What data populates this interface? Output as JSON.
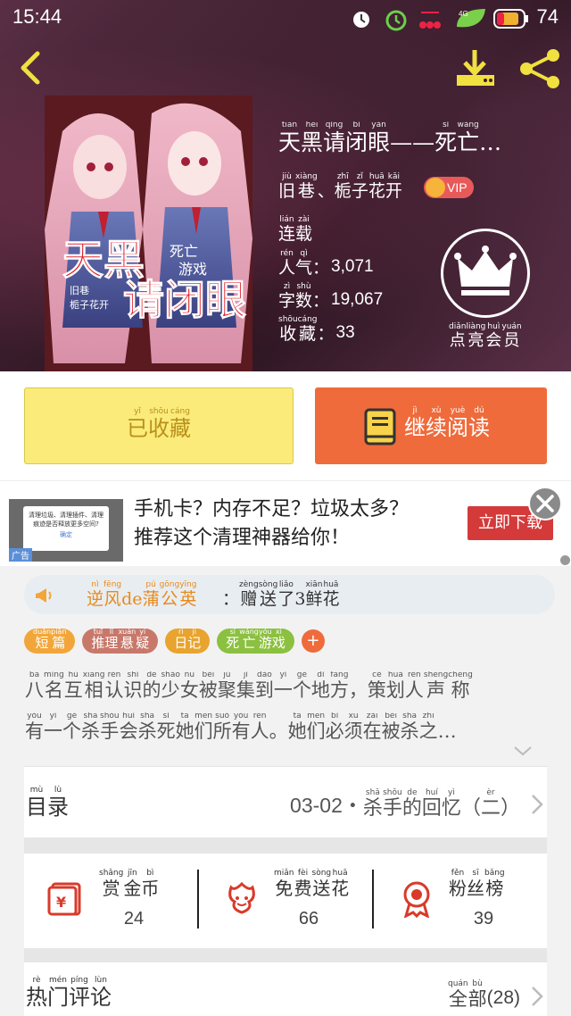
{
  "status_bar": {
    "time": "15:44",
    "battery": "74",
    "network": "4G"
  },
  "colors": {
    "accent_orange": "#ef6b3b",
    "collect_yellow": "#fbeb7a",
    "vip_red": "#e85a5a",
    "gift_user_orange": "#e88a1a"
  },
  "book": {
    "title": [
      {
        "c": "天",
        "p": "tiān"
      },
      {
        "c": "黑",
        "p": "hēi"
      },
      {
        "c": "请",
        "p": "qǐng"
      },
      {
        "c": "闭",
        "p": "bì"
      },
      {
        "c": "眼",
        "p": "yǎn"
      },
      {
        "c": "——",
        "p": ""
      },
      {
        "c": "死",
        "p": "sǐ"
      },
      {
        "c": "亡",
        "p": "wáng"
      },
      {
        "c": "…",
        "p": ""
      }
    ],
    "author": [
      {
        "c": "旧",
        "p": "jiù"
      },
      {
        "c": "巷",
        "p": "xiàng"
      },
      {
        "c": "、",
        "p": ""
      },
      {
        "c": "栀",
        "p": "zhī"
      },
      {
        "c": "子",
        "p": "zǐ"
      },
      {
        "c": "花",
        "p": "huā"
      },
      {
        "c": "开",
        "p": "kāi"
      }
    ],
    "vip_label": "VIP",
    "status": [
      {
        "c": "连",
        "p": "lián"
      },
      {
        "c": "载",
        "p": "zài"
      }
    ],
    "popularity_label": [
      {
        "c": "人",
        "p": "rén"
      },
      {
        "c": "气",
        "p": "qì"
      },
      {
        "c": "：",
        "p": ""
      }
    ],
    "popularity": "3,071",
    "word_count_label": [
      {
        "c": "字",
        "p": "zì"
      },
      {
        "c": "数",
        "p": "shù"
      },
      {
        "c": "：",
        "p": ""
      }
    ],
    "word_count": "19,067",
    "favorites_label": [
      {
        "c": "收",
        "p": "shōu"
      },
      {
        "c": "藏",
        "p": "cáng"
      },
      {
        "c": "：",
        "p": ""
      }
    ],
    "favorites": "33",
    "member_label": [
      {
        "c": "点",
        "p": "diǎn"
      },
      {
        "c": "亮",
        "p": "liàng"
      },
      {
        "c": "会",
        "p": "huì"
      },
      {
        "c": "员",
        "p": "yuán"
      }
    ]
  },
  "actions": {
    "collect": [
      {
        "c": "已",
        "p": "yǐ"
      },
      {
        "c": "收",
        "p": "shōu"
      },
      {
        "c": "藏",
        "p": "cáng"
      }
    ],
    "read": [
      {
        "c": "继",
        "p": "jì"
      },
      {
        "c": "续",
        "p": "xù"
      },
      {
        "c": "阅",
        "p": "yuè"
      },
      {
        "c": "读",
        "p": "dú"
      }
    ]
  },
  "ad": {
    "line1": "手机卡？内存不足？垃圾太多？",
    "line2": "推荐这个清理神器给你！",
    "cta": "立即下载",
    "tag": "广告",
    "thumb_text": "清理垃圾、清理插件、清理痕迹是否释放更多空间?",
    "thumb_ok": "确定"
  },
  "gift": {
    "user": [
      {
        "c": "逆",
        "p": "nì"
      },
      {
        "c": "风",
        "p": "fēng"
      },
      {
        "c": "de",
        "p": ""
      },
      {
        "c": "蒲",
        "p": "pú"
      },
      {
        "c": "公",
        "p": "gōng"
      },
      {
        "c": "英",
        "p": "yīng"
      }
    ],
    "action": [
      {
        "c": "：",
        "p": ""
      },
      {
        "c": "赠",
        "p": "zèng"
      },
      {
        "c": "送",
        "p": "sòng"
      },
      {
        "c": "了",
        "p": "liǎo"
      },
      {
        "c": "3",
        "p": ""
      },
      {
        "c": "鲜",
        "p": "xiān"
      },
      {
        "c": "花",
        "p": "huā"
      }
    ]
  },
  "tags": [
    {
      "color": "#f2a63a",
      "chars": [
        {
          "c": "短",
          "p": "duǎn"
        },
        {
          "c": "篇",
          "p": "piān"
        }
      ]
    },
    {
      "color": "#c8786a",
      "chars": [
        {
          "c": "推",
          "p": "tuī"
        },
        {
          "c": "理",
          "p": "lǐ"
        },
        {
          "c": "悬",
          "p": "xuán"
        },
        {
          "c": "疑",
          "p": "yí"
        }
      ]
    },
    {
      "color": "#e8a42e",
      "chars": [
        {
          "c": "日",
          "p": "rì"
        },
        {
          "c": "记",
          "p": "jì"
        }
      ]
    },
    {
      "color": "#8cc040",
      "chars": [
        {
          "c": "死",
          "p": "sǐ"
        },
        {
          "c": "亡",
          "p": "wáng"
        },
        {
          "c": "游",
          "p": "yóu"
        },
        {
          "c": "戏",
          "p": "xì"
        }
      ]
    }
  ],
  "tag_add": "+",
  "synopsis": {
    "line1": [
      {
        "c": "八",
        "p": "bā"
      },
      {
        "c": "名",
        "p": "míng"
      },
      {
        "c": "互",
        "p": "hù"
      },
      {
        "c": "相",
        "p": "xiāng"
      },
      {
        "c": "认",
        "p": "rèn"
      },
      {
        "c": "识",
        "p": "shí"
      },
      {
        "c": "的",
        "p": "de"
      },
      {
        "c": "少",
        "p": "shǎo"
      },
      {
        "c": "女",
        "p": "nǚ"
      },
      {
        "c": "被",
        "p": "bèi"
      },
      {
        "c": "聚",
        "p": "jù"
      },
      {
        "c": "集",
        "p": "jí"
      },
      {
        "c": "到",
        "p": "dào"
      },
      {
        "c": "一",
        "p": "yí"
      },
      {
        "c": "个",
        "p": "gè"
      },
      {
        "c": "地",
        "p": "dì"
      },
      {
        "c": "方",
        "p": "fāng"
      },
      {
        "c": "，",
        "p": ""
      },
      {
        "c": "策",
        "p": "cè"
      },
      {
        "c": "划",
        "p": "huà"
      },
      {
        "c": "人",
        "p": "rén"
      },
      {
        "c": "声",
        "p": "shēng"
      },
      {
        "c": "称",
        "p": "chēng"
      }
    ],
    "line2": [
      {
        "c": "有",
        "p": "yǒu"
      },
      {
        "c": "一",
        "p": "yí"
      },
      {
        "c": "个",
        "p": "gè"
      },
      {
        "c": "杀",
        "p": "shā"
      },
      {
        "c": "手",
        "p": "shǒu"
      },
      {
        "c": "会",
        "p": "huì"
      },
      {
        "c": "杀",
        "p": "shā"
      },
      {
        "c": "死",
        "p": "sǐ"
      },
      {
        "c": "她",
        "p": "tā"
      },
      {
        "c": "们",
        "p": "men"
      },
      {
        "c": "所",
        "p": "suǒ"
      },
      {
        "c": "有",
        "p": "yǒu"
      },
      {
        "c": "人",
        "p": "rén"
      },
      {
        "c": "。",
        "p": ""
      },
      {
        "c": "她",
        "p": "tā"
      },
      {
        "c": "们",
        "p": "men"
      },
      {
        "c": "必",
        "p": "bì"
      },
      {
        "c": "须",
        "p": "xū"
      },
      {
        "c": "在",
        "p": "zài"
      },
      {
        "c": "被",
        "p": "bèi"
      },
      {
        "c": "杀",
        "p": "shā"
      },
      {
        "c": "之",
        "p": "zhī"
      },
      {
        "c": "…",
        "p": ""
      }
    ]
  },
  "catalog": {
    "label": [
      {
        "c": "目",
        "p": "mù"
      },
      {
        "c": "录",
        "p": "lù"
      }
    ],
    "latest_num": "03-02・",
    "latest_title": [
      {
        "c": "杀",
        "p": "shā"
      },
      {
        "c": "手",
        "p": "shǒu"
      },
      {
        "c": "的",
        "p": "de"
      },
      {
        "c": "回",
        "p": "huí"
      },
      {
        "c": "忆",
        "p": "yì"
      },
      {
        "c": "（",
        "p": ""
      },
      {
        "c": "二",
        "p": "èr"
      },
      {
        "c": "）",
        "p": ""
      }
    ]
  },
  "stats": [
    {
      "label": [
        {
          "c": "赏",
          "p": "shǎng"
        },
        {
          "c": "金",
          "p": "jīn"
        },
        {
          "c": "币",
          "p": "bì"
        }
      ],
      "value": "24",
      "icon": "red-envelope-icon"
    },
    {
      "label": [
        {
          "c": "免",
          "p": "miǎn"
        },
        {
          "c": "费",
          "p": "fèi"
        },
        {
          "c": "送",
          "p": "sòng"
        },
        {
          "c": "花",
          "p": "huā"
        }
      ],
      "value": "66",
      "icon": "flower-icon"
    },
    {
      "label": [
        {
          "c": "粉",
          "p": "fěn"
        },
        {
          "c": "丝",
          "p": "sī"
        },
        {
          "c": "榜",
          "p": "bǎng"
        }
      ],
      "value": "39",
      "icon": "medal-icon"
    }
  ],
  "comments": {
    "label": [
      {
        "c": "热",
        "p": "rè"
      },
      {
        "c": "门",
        "p": "mén"
      },
      {
        "c": "评",
        "p": "píng"
      },
      {
        "c": "论",
        "p": "lùn"
      }
    ],
    "all_label": [
      {
        "c": "全",
        "p": "quán"
      },
      {
        "c": "部",
        "p": "bù"
      }
    ],
    "count": "(28)"
  }
}
